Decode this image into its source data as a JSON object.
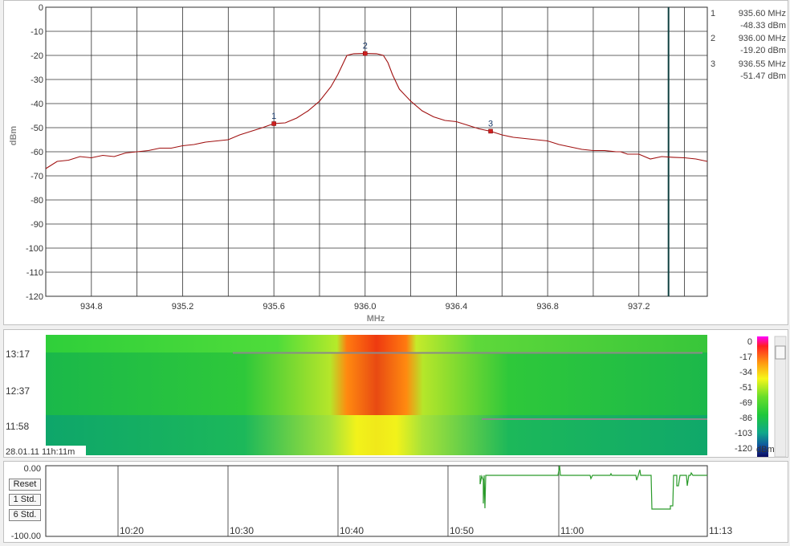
{
  "spectrum": {
    "y_unit": "dBm",
    "x_unit": "MHz",
    "y_ticks": [
      "0",
      "-10",
      "-20",
      "-30",
      "-40",
      "-50",
      "-60",
      "-70",
      "-80",
      "-90",
      "-100",
      "-110",
      "-120"
    ],
    "x_ticks": [
      "934.8",
      "935.2",
      "935.6",
      "936.0",
      "936.4",
      "936.8",
      "937.2"
    ],
    "markers": [
      {
        "num": "1",
        "freq": "935.60 MHz",
        "level": "-48.33 dBm",
        "x": 935.6,
        "y": -48.33
      },
      {
        "num": "2",
        "freq": "936.00 MHz",
        "level": "-19.20 dBm",
        "x": 936.0,
        "y": -19.2
      },
      {
        "num": "3",
        "freq": "936.55 MHz",
        "level": "-51.47 dBm",
        "x": 936.55,
        "y": -51.47
      }
    ]
  },
  "chart_data": {
    "type": "line",
    "xlabel": "MHz",
    "ylabel": "dBm",
    "xlim": [
      934.6,
      937.5
    ],
    "ylim": [
      -120,
      0
    ],
    "grid": true,
    "cursor_x": 937.33,
    "series": [
      {
        "x": [
          934.6,
          934.65,
          934.7,
          934.75,
          934.8,
          934.85,
          934.9,
          934.95,
          935.0,
          935.05,
          935.1,
          935.15,
          935.2,
          935.25,
          935.3,
          935.35,
          935.4,
          935.45,
          935.5,
          935.55,
          935.6,
          935.65,
          935.7,
          935.75,
          935.8,
          935.85,
          935.88,
          935.9,
          935.92,
          935.95,
          936.0,
          936.05,
          936.08,
          936.1,
          936.12,
          936.15,
          936.2,
          936.25,
          936.3,
          936.35,
          936.4,
          936.45,
          936.5,
          936.55,
          936.6,
          936.65,
          936.7,
          936.75,
          936.8,
          936.85,
          936.9,
          936.95,
          937.0,
          937.05,
          937.1,
          937.12,
          937.15,
          937.2,
          937.25,
          937.3,
          937.35,
          937.4,
          937.45,
          937.5
        ],
        "y": [
          -67,
          -64,
          -63.5,
          -62,
          -62.5,
          -61.5,
          -62,
          -60.5,
          -60,
          -59.5,
          -58.5,
          -58.5,
          -57.5,
          -57,
          -56,
          -55.5,
          -55,
          -53,
          -51.5,
          -50,
          -48.3,
          -48,
          -46,
          -43,
          -39,
          -33,
          -28,
          -24,
          -20,
          -19.3,
          -19.2,
          -19.3,
          -20,
          -23,
          -28,
          -34,
          -39,
          -43,
          -45.5,
          -47,
          -47.5,
          -49,
          -50.5,
          -51.5,
          -53,
          -54,
          -54.5,
          -55,
          -55.5,
          -57,
          -58,
          -59,
          -59.5,
          -59.5,
          -60,
          -60,
          -61,
          -61,
          -63,
          -62,
          -62.3,
          -62.5,
          -63,
          -64
        ]
      }
    ]
  },
  "waterfall": {
    "time_labels": [
      "13:17",
      "12:37",
      "11:58"
    ],
    "footer_label": "28.01.11 11h:11m",
    "colorbar_ticks": [
      "0",
      "-17",
      "-34",
      "-51",
      "-69",
      "-86",
      "-103",
      "-120"
    ],
    "colorbar_unit": "dBm"
  },
  "timeline": {
    "y_top": "0.00",
    "y_bottom": "-100.00",
    "time_ticks": [
      "10:20",
      "10:30",
      "10:40",
      "10:50",
      "11:00",
      "11:13"
    ],
    "buttons": {
      "reset": "Reset",
      "std1": "1 Std.",
      "std6": "6 Std."
    }
  },
  "colors": {
    "trace": "#a01010",
    "cursor": "#104040",
    "marker": "#d02020",
    "activity": "#2a9a2a",
    "grid": "#303030",
    "label": "#444444"
  }
}
